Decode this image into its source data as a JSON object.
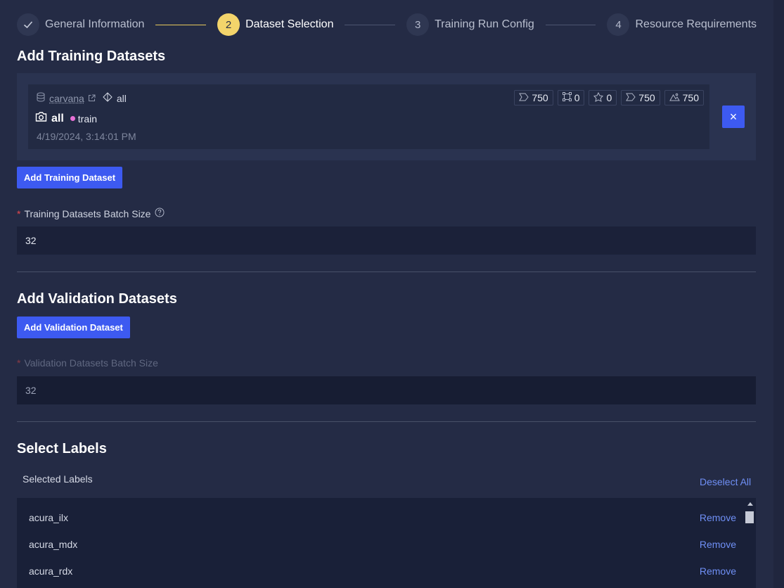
{
  "steps": [
    {
      "number": "✓",
      "label": "General Information",
      "state": "done"
    },
    {
      "number": "2",
      "label": "Dataset Selection",
      "state": "active"
    },
    {
      "number": "3",
      "label": "Training Run Config",
      "state": "pending"
    },
    {
      "number": "4",
      "label": "Resource Requirements",
      "state": "pending"
    }
  ],
  "training": {
    "title": "Add Training Datasets",
    "dataset": {
      "project": "carvana",
      "version": "all",
      "name": "all",
      "tag": "train",
      "date": "4/19/2024, 3:14:01 PM",
      "stats": [
        "750",
        "0",
        "0",
        "750",
        "750"
      ]
    },
    "add_button": "Add Training Dataset",
    "remove_button": "×",
    "batch_label": "Training Datasets Batch Size",
    "batch_value": "32"
  },
  "validation": {
    "title": "Add Validation Datasets",
    "add_button": "Add Validation Dataset",
    "batch_label": "Validation Datasets Batch Size",
    "batch_value": "32"
  },
  "labels": {
    "title": "Select Labels",
    "selected_heading": "Selected Labels",
    "deselect_all": "Deselect All",
    "remove_label": "Remove",
    "items": [
      "acura_ilx",
      "acura_mdx",
      "acura_rdx"
    ]
  },
  "colors": {
    "accent": "#3d5af1",
    "step_active": "#f3d46b",
    "tag_dot": "#e870d6",
    "required": "#e5484d"
  }
}
